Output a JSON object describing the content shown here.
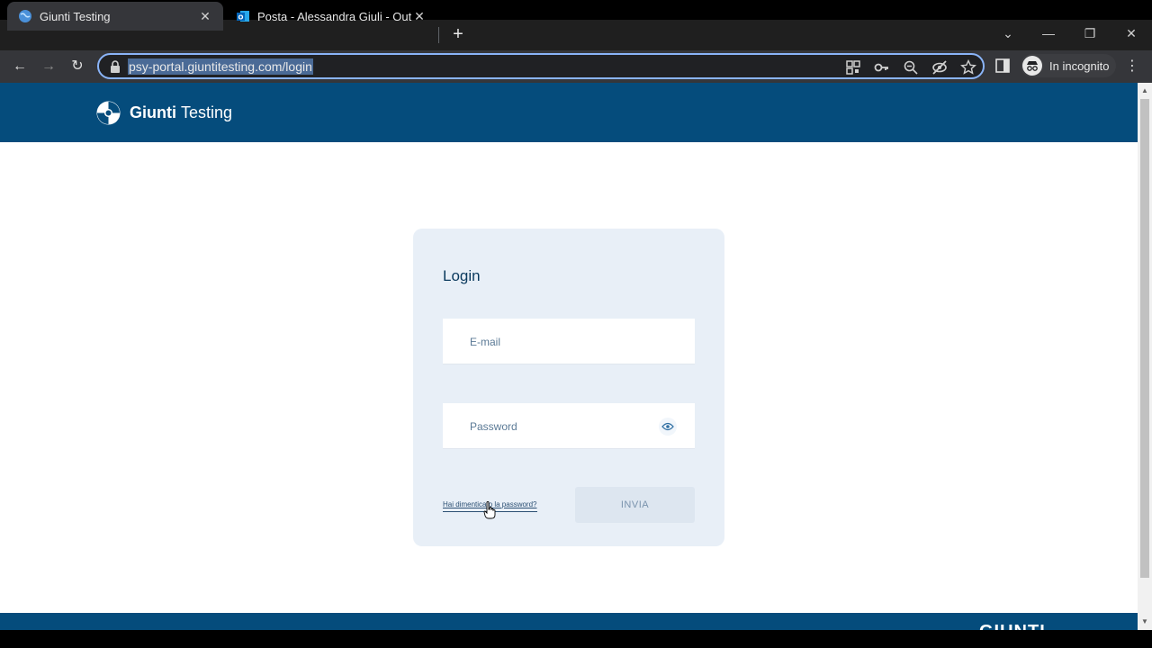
{
  "browser": {
    "tabs": [
      {
        "title": "Giunti Testing",
        "close": "✕"
      },
      {
        "title": "Posta - Alessandra Giuli - Outlook",
        "close": "✕"
      }
    ],
    "new_tab": "+",
    "window_controls": {
      "dropdown": "⌄",
      "minimize": "—",
      "restore": "❐",
      "close": "✕"
    },
    "nav": {
      "back": "←",
      "forward": "→",
      "reload": "↻"
    },
    "url": "psy-portal.giuntitesting.com/login",
    "incognito_label": "In incognito",
    "menu": "⋮"
  },
  "site": {
    "logo_bold": "Giunti",
    "logo_light": "Testing",
    "footer_logo": "GIUNTI"
  },
  "login": {
    "title": "Login",
    "email_placeholder": "E-mail",
    "password_placeholder": "Password",
    "forgot_link": "Hai dimenticato la password?",
    "submit": "INVIA"
  },
  "colors": {
    "header": "#054c7c",
    "card": "#e8eff7",
    "accent": "#8ab4f8"
  }
}
